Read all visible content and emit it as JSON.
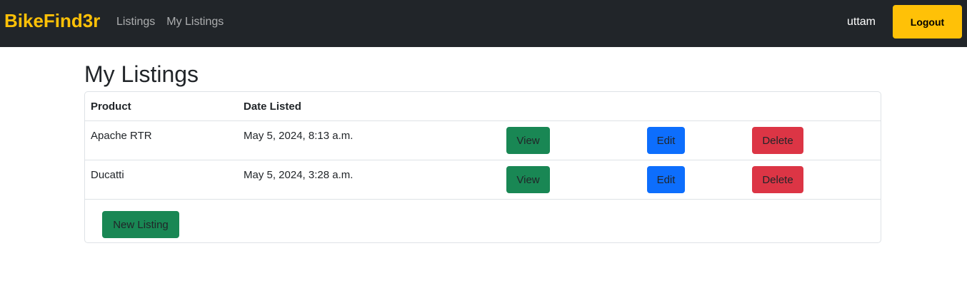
{
  "navbar": {
    "brand": "BikeFind3r",
    "links": [
      "Listings",
      "My Listings"
    ],
    "username": "uttam",
    "logout_label": "Logout"
  },
  "page": {
    "title": "My Listings"
  },
  "table": {
    "headers": [
      "Product",
      "Date Listed"
    ],
    "rows": [
      {
        "product": "Apache RTR",
        "date": "May 5, 2024, 8:13 a.m.",
        "view_label": "View",
        "edit_label": "Edit",
        "delete_label": "Delete"
      },
      {
        "product": "Ducatti",
        "date": "May 5, 2024, 3:28 a.m.",
        "view_label": "View",
        "edit_label": "Edit",
        "delete_label": "Delete"
      }
    ]
  },
  "actions": {
    "new_listing_label": "New Listing"
  },
  "colors": {
    "navbar_bg": "#212529",
    "brand": "#ffc107",
    "view": "#198754",
    "edit": "#0d6efd",
    "delete": "#dc3545"
  }
}
